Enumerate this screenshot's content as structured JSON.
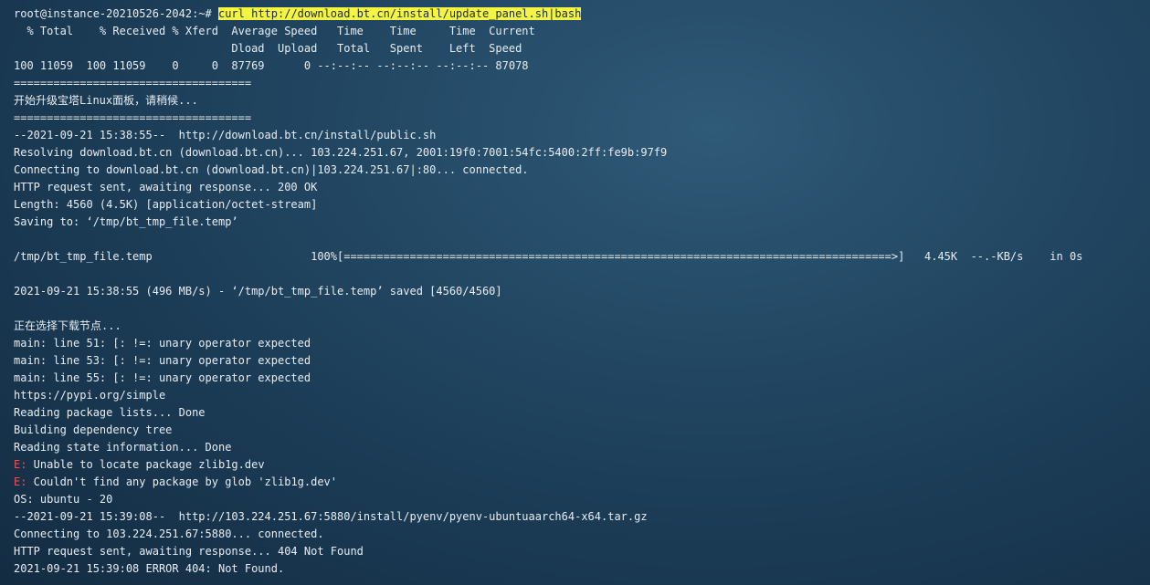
{
  "terminal": {
    "lines": [
      {
        "segments": [
          {
            "text": "root@instance-20210526-2042:~# ",
            "style": "normal"
          },
          {
            "text": "curl http://download.bt.cn/install/update_panel.sh|bash",
            "style": "highlight"
          }
        ]
      },
      {
        "segments": [
          {
            "text": "  % Total    % Received % Xferd  Average Speed   Time    Time     Time  Current",
            "style": "normal"
          }
        ]
      },
      {
        "segments": [
          {
            "text": "                                 Dload  Upload   Total   Spent    Left  Speed",
            "style": "normal"
          }
        ]
      },
      {
        "segments": [
          {
            "text": "100 11059  100 11059    0     0  87769      0 --:--:-- --:--:-- --:--:-- 87078",
            "style": "normal"
          }
        ]
      },
      {
        "segments": [
          {
            "text": "====================================",
            "style": "normal"
          }
        ]
      },
      {
        "segments": [
          {
            "text": "开始升级宝塔Linux面板，请稍候...",
            "style": "normal"
          }
        ]
      },
      {
        "segments": [
          {
            "text": "====================================",
            "style": "normal"
          }
        ]
      },
      {
        "segments": [
          {
            "text": "--2021-09-21 15:38:55--  http://download.bt.cn/install/public.sh",
            "style": "normal"
          }
        ]
      },
      {
        "segments": [
          {
            "text": "Resolving download.bt.cn (download.bt.cn)... 103.224.251.67, 2001:19f0:7001:54fc:5400:2ff:fe9b:97f9",
            "style": "normal"
          }
        ]
      },
      {
        "segments": [
          {
            "text": "Connecting to download.bt.cn (download.bt.cn)|103.224.251.67|:80... connected.",
            "style": "normal"
          }
        ]
      },
      {
        "segments": [
          {
            "text": "HTTP request sent, awaiting response... 200 OK",
            "style": "normal"
          }
        ]
      },
      {
        "segments": [
          {
            "text": "Length: 4560 (4.5K) [application/octet-stream]",
            "style": "normal"
          }
        ]
      },
      {
        "segments": [
          {
            "text": "Saving to: ‘/tmp/bt_tmp_file.temp’",
            "style": "normal"
          }
        ]
      },
      {
        "segments": [
          {
            "text": "",
            "style": "normal"
          }
        ]
      },
      {
        "segments": [
          {
            "text": "/tmp/bt_tmp_file.temp                        100%[===================================================================================>]   4.45K  --.-KB/s    in 0s",
            "style": "normal"
          }
        ]
      },
      {
        "segments": [
          {
            "text": "",
            "style": "normal"
          }
        ]
      },
      {
        "segments": [
          {
            "text": "2021-09-21 15:38:55 (496 MB/s) - ‘/tmp/bt_tmp_file.temp’ saved [4560/4560]",
            "style": "normal"
          }
        ]
      },
      {
        "segments": [
          {
            "text": "",
            "style": "normal"
          }
        ]
      },
      {
        "segments": [
          {
            "text": "正在选择下载节点...",
            "style": "normal"
          }
        ]
      },
      {
        "segments": [
          {
            "text": "main: line 51: [: !=: unary operator expected",
            "style": "normal"
          }
        ]
      },
      {
        "segments": [
          {
            "text": "main: line 53: [: !=: unary operator expected",
            "style": "normal"
          }
        ]
      },
      {
        "segments": [
          {
            "text": "main: line 55: [: !=: unary operator expected",
            "style": "normal"
          }
        ]
      },
      {
        "segments": [
          {
            "text": "https://pypi.org/simple",
            "style": "normal"
          }
        ]
      },
      {
        "segments": [
          {
            "text": "Reading package lists... Done",
            "style": "normal"
          }
        ]
      },
      {
        "segments": [
          {
            "text": "Building dependency tree",
            "style": "normal"
          }
        ]
      },
      {
        "segments": [
          {
            "text": "Reading state information... Done",
            "style": "normal"
          }
        ]
      },
      {
        "segments": [
          {
            "text": "E:",
            "style": "error"
          },
          {
            "text": " Unable to locate package zlib1g.dev",
            "style": "normal"
          }
        ]
      },
      {
        "segments": [
          {
            "text": "E:",
            "style": "error"
          },
          {
            "text": " Couldn't find any package by glob 'zlib1g.dev'",
            "style": "normal"
          }
        ]
      },
      {
        "segments": [
          {
            "text": "OS: ubuntu - 20",
            "style": "normal"
          }
        ]
      },
      {
        "segments": [
          {
            "text": "--2021-09-21 15:39:08--  http://103.224.251.67:5880/install/pyenv/pyenv-ubuntuaarch64-x64.tar.gz",
            "style": "normal"
          }
        ]
      },
      {
        "segments": [
          {
            "text": "Connecting to 103.224.251.67:5880... connected.",
            "style": "normal"
          }
        ]
      },
      {
        "segments": [
          {
            "text": "HTTP request sent, awaiting response... 404 Not Found",
            "style": "normal"
          }
        ]
      },
      {
        "segments": [
          {
            "text": "2021-09-21 15:39:08 ERROR 404: Not Found.",
            "style": "normal"
          }
        ]
      }
    ]
  }
}
